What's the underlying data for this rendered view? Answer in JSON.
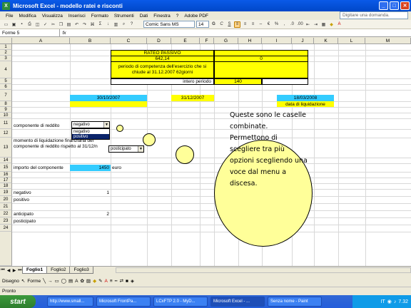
{
  "window": {
    "title": "Microsoft Excel - modello ratei e risconti",
    "app_icon": "excel-icon"
  },
  "menubar": {
    "items": [
      "File",
      "Modifica",
      "Visualizza",
      "Inserisci",
      "Formato",
      "Strumenti",
      "Dati",
      "Finestra",
      "?",
      "Adobe PDF"
    ],
    "help_placeholder": "Digitare una domanda."
  },
  "toolbar": {
    "font": "Comic Sans MS",
    "size": "14"
  },
  "formula_bar": {
    "name_box": "Forme 5",
    "fx": "fx"
  },
  "columns": [
    "A",
    "B",
    "C",
    "D",
    "E",
    "F",
    "G",
    "H",
    "I",
    "J",
    "K",
    "L",
    "M"
  ],
  "rows": [
    "1",
    "2",
    "3",
    "4",
    "5",
    "6",
    "7",
    "8",
    "9",
    "10",
    "11",
    "12",
    "13",
    "14",
    "15",
    "16",
    "17",
    "18",
    "19",
    "20",
    "21",
    "22",
    "23",
    "24"
  ],
  "cells": {
    "rateo_title": "RATEO PASSIVO",
    "c3": "642,14",
    "i3": "0",
    "periodo": "periodo di competenza dell'esercizio che si chiude al 31.12.2007 62giorni",
    "intero_periodo": "intero periodo",
    "h5": "140",
    "b7": "30/10/2007",
    "e7": "31/12/2007",
    "j7": "18/03/2008",
    "j8": "data di liquidazione",
    "a11": "componente di reddito",
    "a13": "momento di liquidazione finanziaria del componente di reddito rispetto al 31/12/n",
    "a15": "importo del componente",
    "b15": "1450",
    "c15": "euro",
    "a19": "negativo",
    "b19": "1",
    "a20": "positivo",
    "a22": "anticipato",
    "b22": "2",
    "a23": "posticipato"
  },
  "combo1": {
    "value": "negativo",
    "options": [
      "negativo",
      "positivo"
    ],
    "selected": "positivo"
  },
  "combo2": {
    "value": "posticipato"
  },
  "callout": {
    "text": "Queste sono le caselle combinate. Permettono di scegliere tra più opzioni scegliendo una voce dal menu a discesa."
  },
  "sheet_tabs": [
    "Foglio1",
    "Foglio2",
    "Foglio3"
  ],
  "drawbar": {
    "draw": "Disegno",
    "shapes": "Forme"
  },
  "status": "Pronto",
  "taskbar": {
    "start": "start",
    "tasks": [
      "http://www.small...",
      "Microsoft FrontPa...",
      "LCxFTP 2.0 - MyD...",
      "Microsoft Excel - ...",
      "Senza nome - Paint"
    ],
    "lang": "IT",
    "clock": "7.32"
  }
}
